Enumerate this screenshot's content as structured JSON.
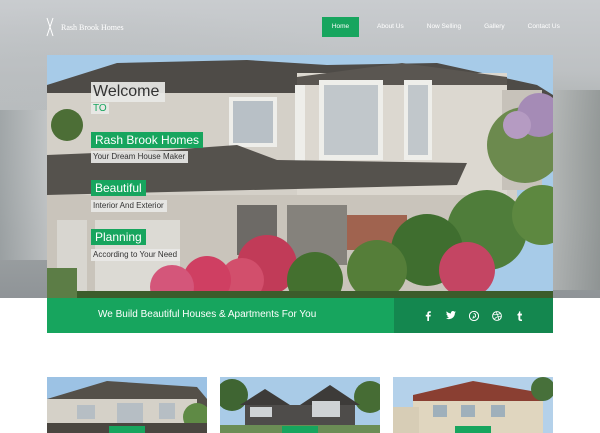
{
  "brand": {
    "name": "Rash Brook Homes"
  },
  "nav": {
    "items": [
      {
        "label": "Home",
        "active": true
      },
      {
        "label": "About Us"
      },
      {
        "label": "Now Selling"
      },
      {
        "label": "Gallery"
      },
      {
        "label": "Contact Us"
      }
    ]
  },
  "hero": {
    "welcome": "Welcome",
    "to": "TO",
    "captions": [
      {
        "title": "Rash Brook Homes",
        "sub": "Your Dream House Maker"
      },
      {
        "title": "Beautiful",
        "sub": "Interior And Exterior"
      },
      {
        "title": "Planning",
        "sub": "According to Your Need"
      }
    ]
  },
  "banner": {
    "text": "We Build Beautiful Houses & Apartments For You",
    "social": [
      "facebook-icon",
      "twitter-icon",
      "pinterest-icon",
      "dribbble-icon",
      "tumblr-icon"
    ]
  },
  "colors": {
    "accent": "#17a55e",
    "accent_dark": "#14874f"
  }
}
